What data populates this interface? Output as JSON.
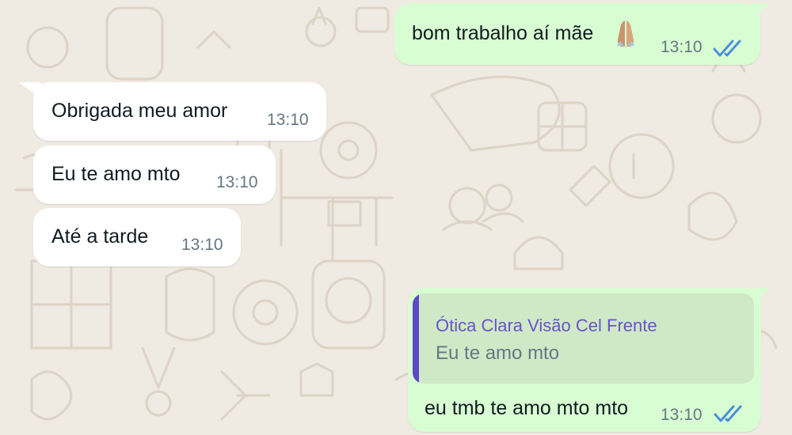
{
  "colors": {
    "background": "#efeae2",
    "incoming_bubble": "#ffffff",
    "outgoing_bubble": "#d9fdd3",
    "read_tick": "#4a90d9",
    "quote_accent": "#5b49c8"
  },
  "messages": [
    {
      "direction": "outgoing",
      "text": "bom trabalho aí mãe",
      "emoji": "folded-hands-emoji",
      "time": "13:10",
      "status": "read"
    },
    {
      "direction": "incoming",
      "text": "Obrigada meu amor",
      "time": "13:10"
    },
    {
      "direction": "incoming",
      "text": "Eu te amo mto",
      "time": "13:10"
    },
    {
      "direction": "incoming",
      "text": "Até a tarde",
      "time": "13:10"
    },
    {
      "direction": "outgoing",
      "quote": {
        "author": "Ótica Clara Visão Cel Frente",
        "text": "Eu te amo mto"
      },
      "text": "eu tmb te amo mto mto",
      "time": "13:10",
      "status": "read"
    }
  ]
}
